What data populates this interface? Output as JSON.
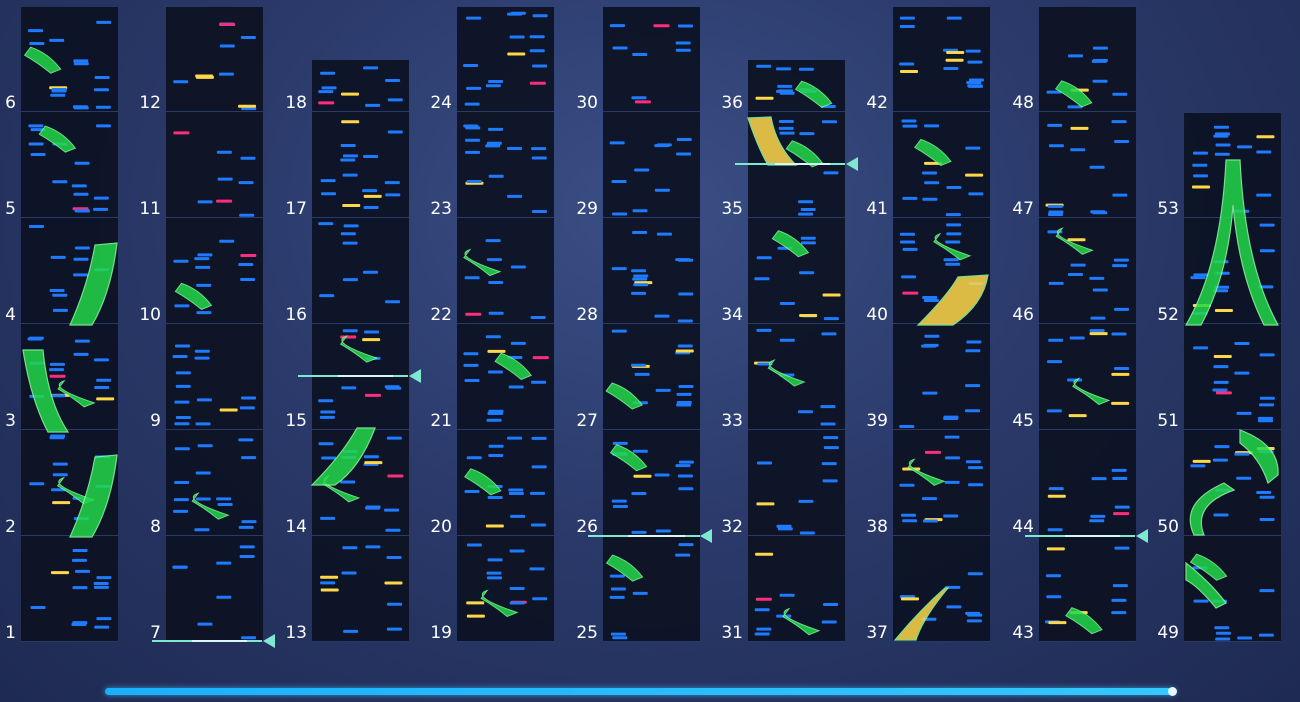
{
  "song_chart": {
    "measure_numbers": [
      "1",
      "2",
      "3",
      "4",
      "5",
      "6",
      "7",
      "8",
      "9",
      "10",
      "11",
      "12",
      "13",
      "14",
      "15",
      "16",
      "17",
      "18",
      "19",
      "20",
      "21",
      "22",
      "23",
      "24",
      "25",
      "26",
      "27",
      "28",
      "29",
      "30",
      "31",
      "32",
      "33",
      "34",
      "35",
      "36",
      "37",
      "38",
      "39",
      "40",
      "41",
      "42",
      "43",
      "44",
      "45",
      "46",
      "47",
      "48",
      "49",
      "50",
      "51",
      "52",
      "53"
    ],
    "columns": [
      {
        "measures": [
          "1",
          "2",
          "3",
          "4",
          "5",
          "6"
        ]
      },
      {
        "measures": [
          "7",
          "8",
          "9",
          "10",
          "11",
          "12"
        ]
      },
      {
        "measures": [
          "13",
          "14",
          "15",
          "16",
          "17",
          "18"
        ]
      },
      {
        "measures": [
          "19",
          "20",
          "21",
          "22",
          "23",
          "24"
        ]
      },
      {
        "measures": [
          "25",
          "26",
          "27",
          "28",
          "29",
          "30"
        ]
      },
      {
        "measures": [
          "31",
          "32",
          "33",
          "34",
          "35",
          "36"
        ]
      },
      {
        "measures": [
          "37",
          "38",
          "39",
          "40",
          "41",
          "42"
        ]
      },
      {
        "measures": [
          "43",
          "44",
          "45",
          "46",
          "47",
          "48"
        ]
      },
      {
        "measures": [
          "49",
          "50",
          "51",
          "52",
          "53"
        ]
      }
    ],
    "colors": {
      "tap_note": "#1e7bff",
      "yellow_note": "#ffd84a",
      "pink_note": "#ff2d7d",
      "slide": "#22d84a",
      "lane_bg": "#0d1222",
      "playhead": "#7fe8d0"
    },
    "icons": [
      "playhead-marker-icon"
    ]
  }
}
